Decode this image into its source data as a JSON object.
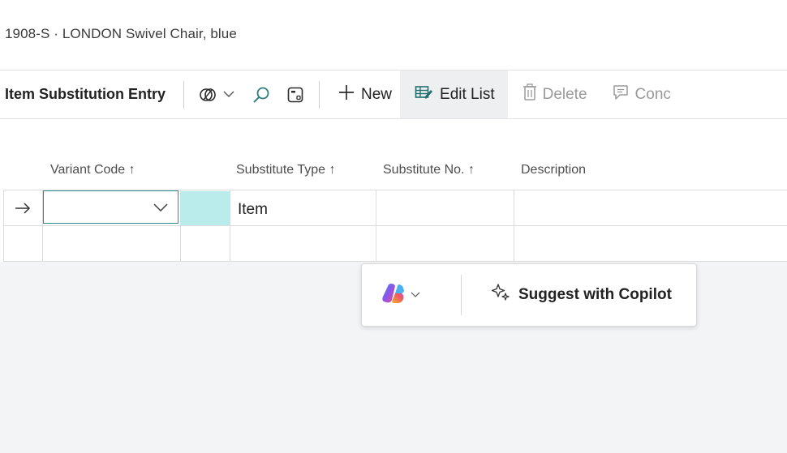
{
  "page": {
    "title": "1908-S · LONDON Swivel Chair, blue"
  },
  "toolbar": {
    "title": "Item Substitution Entry",
    "new_label": "New",
    "edit_list_label": "Edit List",
    "delete_label": "Delete",
    "conc_label": "Conc",
    "icons": [
      "filter-pane-icon",
      "chevron-down-icon",
      "search-icon",
      "layout-icon",
      "plus-icon",
      "edit-list-icon",
      "trash-icon",
      "comment-icon"
    ]
  },
  "grid": {
    "columns": [
      {
        "label": "Variant Code",
        "sort": "↑"
      },
      {
        "label": "Substitute Type",
        "sort": "↑"
      },
      {
        "label": "Substitute No.",
        "sort": "↑"
      },
      {
        "label": "Description",
        "sort": ""
      }
    ],
    "rows": [
      {
        "variant_code": "",
        "substitute_type": "Item",
        "substitute_no": "",
        "description": ""
      },
      {
        "variant_code": "",
        "substitute_type": "",
        "substitute_no": "",
        "description": ""
      }
    ]
  },
  "copilot": {
    "suggest_label": "Suggest with Copilot"
  },
  "colors": {
    "accent_teal": "#b9ecea",
    "focus_border": "#2f8d8d",
    "active_button_bg": "#eeeff1",
    "disabled_text": "#9a9a9a"
  }
}
